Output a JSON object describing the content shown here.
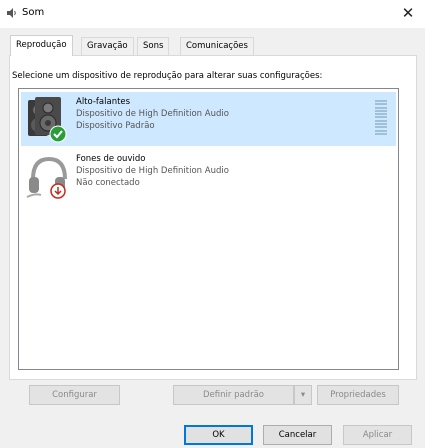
{
  "window": {
    "title": "Som",
    "close_glyph": "✕",
    "icon": "speaker-icon"
  },
  "tabs": [
    {
      "label": "Reprodução",
      "active": true
    },
    {
      "label": "Gravação",
      "active": false
    },
    {
      "label": "Sons",
      "active": false
    },
    {
      "label": "Comunicações",
      "active": false
    }
  ],
  "instruction": "Selecione um dispositivo de reprodução para alterar suas configurações:",
  "devices": [
    {
      "name": "Alto-falantes",
      "description": "Dispositivo de High Definition Audio",
      "status": "Dispositivo Padrão",
      "icon": "speakers-icon",
      "badge": "check-badge-icon",
      "selected": true
    },
    {
      "name": "Fones de ouvido",
      "description": "Dispositivo de High Definition Audio",
      "status": "Não conectado",
      "icon": "headphones-icon",
      "badge": "unplugged-badge-icon",
      "selected": false
    }
  ],
  "panel_buttons": {
    "configure": "Configurar",
    "set_default": "Definir padrão",
    "set_default_arrow": "▾",
    "properties": "Propriedades"
  },
  "dialog_buttons": {
    "ok": "OK",
    "cancel": "Cancelar",
    "apply": "Aplicar"
  },
  "colors": {
    "selection": "#cde8ff",
    "check_badge": "#2a9d3a",
    "unplugged_badge": "#c42b1c",
    "default_button_border": "#0078d7"
  }
}
